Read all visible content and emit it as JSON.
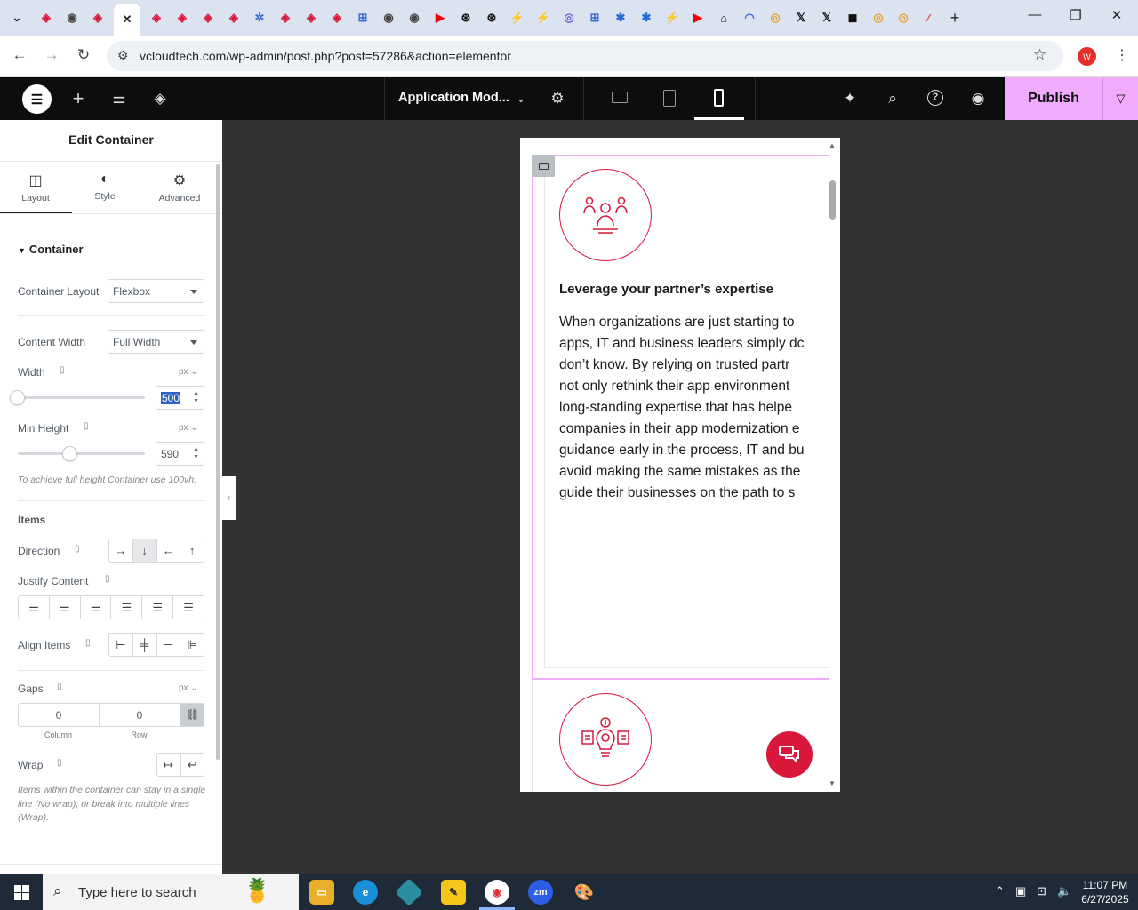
{
  "browser": {
    "url": "vcloudtech.com/wp-admin/post.php?post=57286&action=elementor",
    "profile_initial": "W",
    "new_tab": "+",
    "minimize": "—",
    "restore": "❐",
    "close": "✕"
  },
  "elementor": {
    "document_title": "Application Mod...",
    "publish_label": "Publish",
    "panel": {
      "title": "Edit Container",
      "tabs": [
        {
          "label": "Layout",
          "icon": "layout-icon"
        },
        {
          "label": "Style",
          "icon": "half-circle-icon"
        },
        {
          "label": "Advanced",
          "icon": "gear-icon"
        }
      ],
      "section_title": "Container",
      "container_layout": {
        "label": "Container Layout",
        "value": "Flexbox"
      },
      "content_width": {
        "label": "Content Width",
        "value": "Full Width"
      },
      "width": {
        "label": "Width",
        "unit": "px",
        "value": "500",
        "slider_fraction": 0.0
      },
      "min_height": {
        "label": "Min Height",
        "unit": "px",
        "value": "590",
        "slider_fraction": 0.41
      },
      "min_height_hint": "To achieve full height Container use 100vh.",
      "items_title": "Items",
      "direction": {
        "label": "Direction",
        "options": [
          "→",
          "↓",
          "←",
          "↑"
        ],
        "selected": 1
      },
      "justify_content": {
        "label": "Justify Content"
      },
      "align_items": {
        "label": "Align Items"
      },
      "gaps": {
        "label": "Gaps",
        "unit": "px",
        "column": "0",
        "row": "0",
        "column_label": "Column",
        "row_label": "Row"
      },
      "wrap": {
        "label": "Wrap"
      },
      "wrap_hint": "Items within the container can stay in a single line (No wrap), or break into multiple lines (Wrap)."
    },
    "preview": {
      "heading": "Leverage your partner’s expertise",
      "body_lines": [
        "When organizations are just starting to",
        "apps, IT and business leaders simply dc",
        "don’t know. By relying on trusted partr",
        "not only rethink their app environment",
        "long-standing expertise that has helpe",
        "companies in their app modernization e",
        "guidance early in the process, IT and bu",
        "avoid making the same mistakes as the",
        "guide their businesses on the path to s"
      ]
    }
  },
  "taskbar": {
    "search_placeholder": "Type here to search",
    "time": "11:07 PM",
    "date": "6/27/2025"
  },
  "colors": {
    "accent_pink": "#f0abfc",
    "brand_red": "#d9173b",
    "elementor_dark": "#0c0d0e"
  }
}
